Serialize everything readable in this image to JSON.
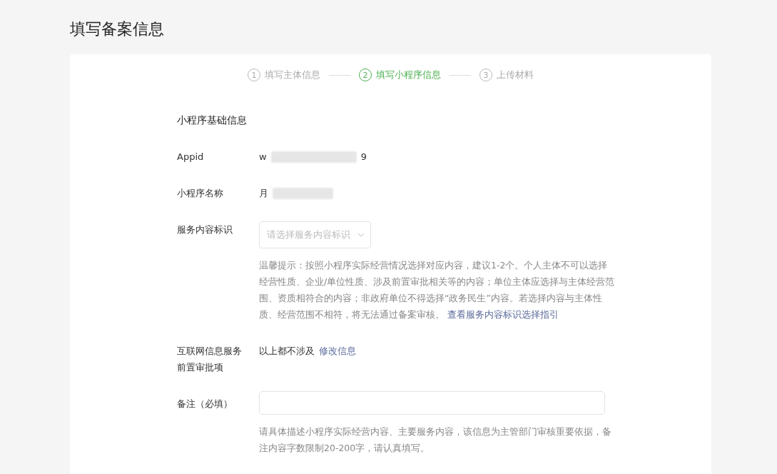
{
  "page_title": "填写备案信息",
  "steps": [
    {
      "number": "1",
      "label": "填写主体信息",
      "selected": false
    },
    {
      "number": "2",
      "label": "填写小程序信息",
      "selected": true
    },
    {
      "number": "3",
      "label": "上传材料",
      "selected": false
    }
  ],
  "section_title": "小程序基础信息",
  "fields": [
    {
      "kind": "redacted",
      "label": "Appid",
      "value_start": "w",
      "value_end": "9"
    },
    {
      "kind": "redacted",
      "label": "小程序名称",
      "value_start": "月"
    },
    {
      "kind": "select",
      "label": "服务内容标识",
      "placeholder": "请选择服务内容标识",
      "hint": "温馨提示：按照小程序实际经营情况选择对应内容，建议1-2个。个人主体不可以选择经营性质、企业/单位性质、涉及前置审批相关等的内容；单位主体应选择与主体经营范围、资质相符合的内容；非政府单位不得选择“政务民生”内容。若选择内容与主体性质、经营范围不相符，将无法通过备案审核。",
      "hint_link": "查看服务内容标识选择指引"
    },
    {
      "kind": "text_link",
      "label": "互联网信息服务前置审批项",
      "value": "以上都不涉及",
      "link": "修改信息"
    },
    {
      "kind": "input",
      "label": "备注（必填）",
      "hint": "请具体描述小程序实际经营内容、主要服务内容，该信息为主管部门审核重要依据，备注内容字数限制20-200字，请认真填写。"
    }
  ]
}
